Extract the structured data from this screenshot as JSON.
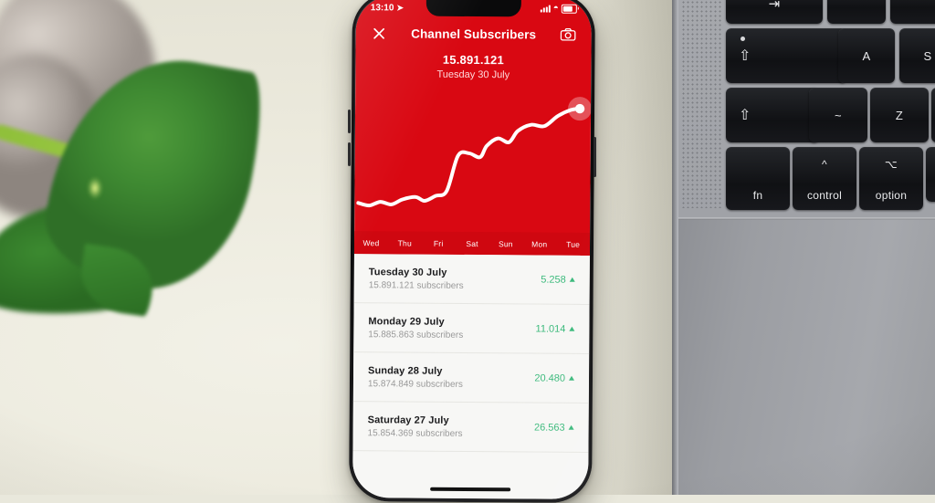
{
  "scene": {
    "background_color": "#e9e8dc",
    "objects": [
      "potted-plant",
      "smartphone",
      "laptop-keyboard"
    ]
  },
  "phone": {
    "status_bar": {
      "time": "13:10",
      "location_icon": "location-arrow-icon",
      "signal_icon": "cellular-signal-icon",
      "wifi_icon": "wifi-icon",
      "battery_icon": "battery-icon"
    },
    "nav": {
      "close_icon": "close-icon",
      "title": "Channel Subscribers",
      "camera_icon": "camera-icon"
    },
    "hero": {
      "value": "15.891.121",
      "date": "Tuesday 30 July",
      "background_color": "#d90812",
      "line_color": "#ffffff"
    },
    "home_indicator": "home-indicator"
  },
  "chart_data": {
    "type": "line",
    "title": "Channel Subscribers",
    "xlabel": "",
    "ylabel": "Subscribers",
    "categories": [
      "Wed",
      "Thu",
      "Fri",
      "Sat",
      "Sun",
      "Mon",
      "Tue"
    ],
    "x": [
      "Wed",
      "Thu",
      "Fri",
      "Sat",
      "Sun",
      "Mon",
      "Tue"
    ],
    "values": [
      15770000,
      15790000,
      15827806,
      15854369,
      15874849,
      15885863,
      15891121
    ],
    "ylim": [
      15760000,
      15900000
    ],
    "grid": false,
    "legend": null,
    "line_color": "#ffffff",
    "highlight_point": {
      "x": "Tue",
      "y": 15891121,
      "label": "15.891.121"
    },
    "points_normalized": [
      [
        0.0,
        0.82
      ],
      [
        0.05,
        0.84
      ],
      [
        0.1,
        0.81
      ],
      [
        0.15,
        0.83
      ],
      [
        0.2,
        0.79
      ],
      [
        0.26,
        0.77
      ],
      [
        0.3,
        0.8
      ],
      [
        0.35,
        0.76
      ],
      [
        0.4,
        0.72
      ],
      [
        0.45,
        0.44
      ],
      [
        0.5,
        0.42
      ],
      [
        0.55,
        0.45
      ],
      [
        0.58,
        0.36
      ],
      [
        0.63,
        0.3
      ],
      [
        0.68,
        0.33
      ],
      [
        0.72,
        0.24
      ],
      [
        0.78,
        0.19
      ],
      [
        0.84,
        0.2
      ],
      [
        0.9,
        0.12
      ],
      [
        0.96,
        0.07
      ],
      [
        1.0,
        0.06
      ]
    ]
  },
  "list": {
    "rows": [
      {
        "date": "Tuesday 30 July",
        "subscribers": "15.891.121 subscribers",
        "delta": "5.258",
        "trend": "up"
      },
      {
        "date": "Monday 29 July",
        "subscribers": "15.885.863 subscribers",
        "delta": "11.014",
        "trend": "up"
      },
      {
        "date": "Sunday 28 July",
        "subscribers": "15.874.849 subscribers",
        "delta": "20.480",
        "trend": "up"
      },
      {
        "date": "Saturday 27 July",
        "subscribers": "15.854.369 subscribers",
        "delta": "26.563",
        "trend": "up"
      }
    ],
    "delta_color": "#3cba7c"
  },
  "laptop": {
    "keys": [
      {
        "label": "⇥",
        "sub": ""
      },
      {
        "label": "",
        "sub": ""
      },
      {
        "label": "",
        "sub": ""
      },
      {
        "label": "A",
        "sub": ""
      },
      {
        "label": "S",
        "sub": ""
      },
      {
        "label": "⇧",
        "sub": ""
      },
      {
        "label": "~",
        "sub": ""
      },
      {
        "label": "Z",
        "sub": ""
      },
      {
        "label": "fn",
        "sub": ""
      },
      {
        "label": "control",
        "sub": "^"
      },
      {
        "label": "option",
        "sub": "⌥"
      }
    ],
    "caps_lock_glyph": "⇧",
    "shift_glyph": "⇧",
    "tab_glyph": "⇥",
    "control_glyph": "^",
    "option_glyph": "⌥",
    "fn_label": "fn",
    "control_label": "control",
    "option_label": "option",
    "key_a": "A",
    "key_s": "S",
    "key_z": "Z",
    "key_tilde": "~"
  }
}
